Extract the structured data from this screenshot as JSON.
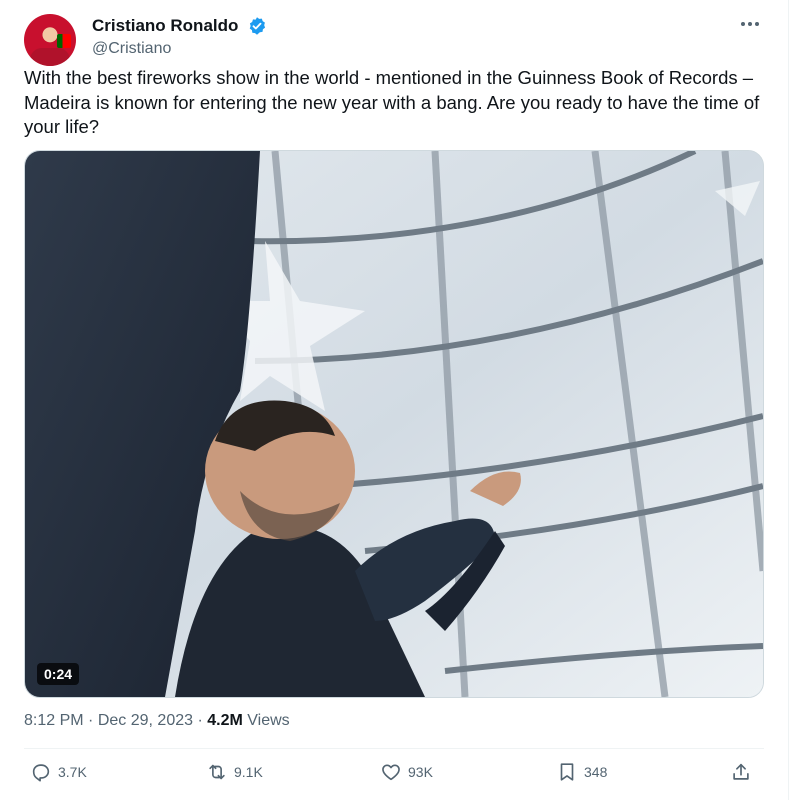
{
  "author": {
    "display_name": "Cristiano Ronaldo",
    "handle": "@Cristiano",
    "verified": true,
    "verified_color": "#1d9bf0"
  },
  "menu": {
    "more_icon": "more-horizontal-icon"
  },
  "tweet": {
    "text": "With the best fireworks show in the world - mentioned in the Guinness Book of Records – Madeira is known for entering the new year with a bang. Are you ready to have the time of your life?"
  },
  "media": {
    "type": "video",
    "duration": "0:24"
  },
  "meta": {
    "time": "8:12 PM",
    "separator": "·",
    "date": "Dec 29, 2023",
    "views_count": "4.2M",
    "views_label": "Views"
  },
  "actions": {
    "replies": "3.7K",
    "retweets": "9.1K",
    "likes": "93K",
    "bookmarks": "348"
  }
}
